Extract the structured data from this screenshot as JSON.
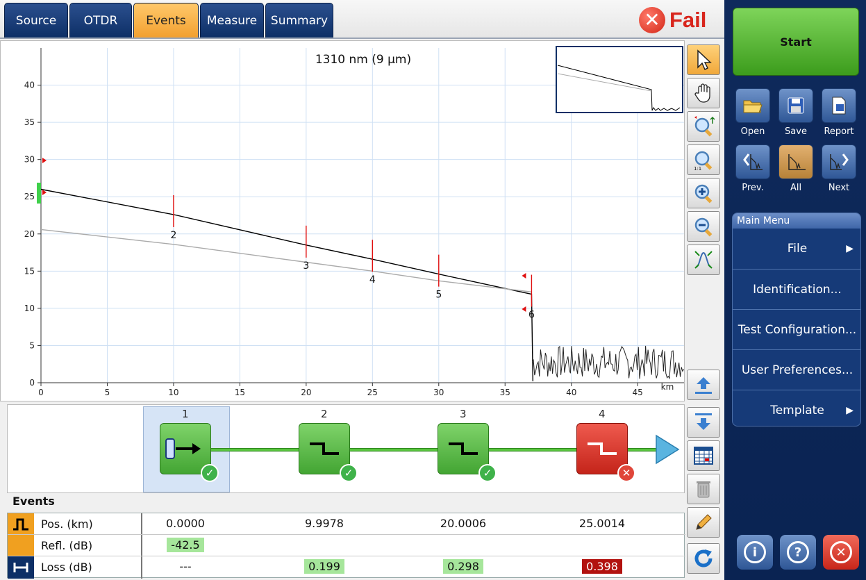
{
  "tabs": [
    {
      "label": "Source",
      "active": false
    },
    {
      "label": "OTDR",
      "active": false
    },
    {
      "label": "Events",
      "active": true
    },
    {
      "label": "Measure",
      "active": false
    },
    {
      "label": "Summary",
      "active": false
    }
  ],
  "status": {
    "text": "Fail",
    "color": "#d8251c"
  },
  "chart": {
    "title": "1310 nm (9 µm)",
    "x_unit": "km",
    "x_ticks": [
      "0",
      "5",
      "10",
      "15",
      "20",
      "25",
      "30",
      "35",
      "40",
      "45"
    ],
    "y_ticks": [
      "0",
      "5",
      "10",
      "15",
      "20",
      "25",
      "30",
      "35",
      "40"
    ]
  },
  "chart_data": {
    "type": "line",
    "title": "1310 nm (9 µm)",
    "xlabel": "km",
    "ylabel": "",
    "xlim": [
      0,
      48.5
    ],
    "ylim": [
      0,
      45
    ],
    "grid": true,
    "series": [
      {
        "color": "#000000",
        "x": [
          0,
          10,
          20,
          25,
          30,
          37.0
        ],
        "y": [
          26.0,
          22.6,
          18.5,
          16.6,
          14.6,
          11.9
        ]
      },
      {
        "color": "#aaaaaa",
        "x": [
          0,
          10,
          20,
          25,
          30,
          37.0
        ],
        "y": [
          20.6,
          18.6,
          16.2,
          15.0,
          13.7,
          12.2
        ]
      }
    ],
    "event_markers": [
      {
        "label": "2",
        "x": 10.0
      },
      {
        "label": "3",
        "x": 20.0
      },
      {
        "label": "4",
        "x": 25.0
      },
      {
        "label": "5",
        "x": 30.0
      },
      {
        "label": "6",
        "x": 37.0
      }
    ]
  },
  "event_strip": {
    "events": [
      {
        "num": "1",
        "status": "pass"
      },
      {
        "num": "2",
        "status": "pass"
      },
      {
        "num": "3",
        "status": "pass"
      },
      {
        "num": "4",
        "status": "fail"
      }
    ]
  },
  "events_table": {
    "title": "Events",
    "rows": [
      {
        "label": "Pos. (km)",
        "values": [
          "0.0000",
          "9.9978",
          "20.0006",
          "25.0014"
        ]
      },
      {
        "label": "Refl. (dB)",
        "values": [
          "-42.5",
          "",
          "",
          ""
        ]
      },
      {
        "label": "Loss (dB)",
        "values": [
          "---",
          "0.199",
          "0.298",
          "0.398"
        ]
      }
    ]
  },
  "right_panel": {
    "start_label": "Start",
    "file_buttons": [
      "Open",
      "Save",
      "Report"
    ],
    "nav_buttons": [
      "Prev.",
      "All",
      "Next"
    ],
    "main_menu_title": "Main Menu",
    "menu_items": [
      "File",
      "Identification...",
      "Test Configuration...",
      "User Preferences...",
      "Template"
    ]
  },
  "icons": [
    "select-arrow-icon",
    "pan-hand-icon",
    "zoom-fit-icon",
    "zoom-1to1-icon",
    "zoom-in-icon",
    "zoom-out-icon",
    "auto-zoom-icon",
    "move-up-icon",
    "move-down-icon",
    "table-icon",
    "trash-icon",
    "pencil-icon",
    "refresh-icon",
    "info-icon",
    "help-icon",
    "close-icon"
  ]
}
